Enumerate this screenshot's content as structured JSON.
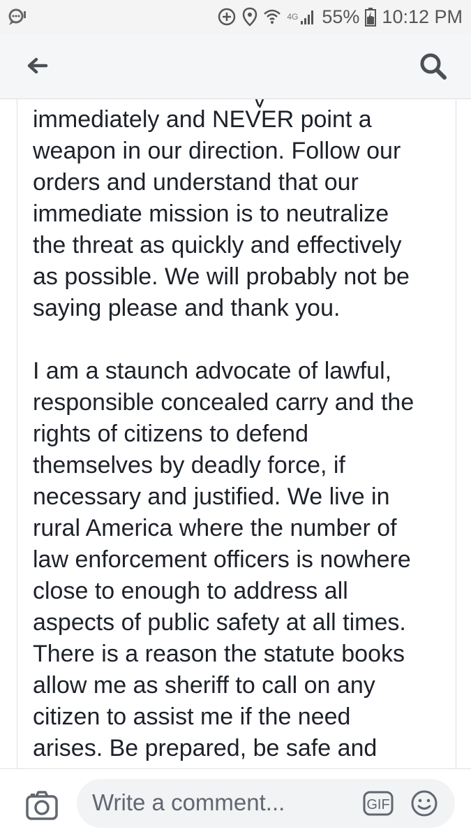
{
  "status_bar": {
    "network": "4G",
    "battery": "55%",
    "time": "10:12 PM"
  },
  "header": {
    "back_icon": "arrow-left-icon",
    "search_icon": "search-icon"
  },
  "post": {
    "paragraphs": [
      {
        "lines": [
          "immediately and NEVER point a",
          "weapon in our direction. Follow our",
          "orders and understand that our",
          "immediate mission is to neutralize",
          "the threat as quickly and effectively",
          "as possible. We will probably not be",
          "saying please and thank you."
        ]
      },
      {
        "lines": [
          "I am a staunch advocate of lawful,",
          "responsible concealed carry and the",
          "rights of citizens to defend",
          "themselves by deadly force, if",
          "necessary and justified. We live in",
          "rural America where the number of",
          "law enforcement officers is nowhere",
          "close to enough to address all",
          "aspects of public safety at all times.",
          "There is a reason the statute books",
          "allow me as sheriff to call on any",
          "citizen to assist me if the need",
          "arises. Be prepared, be safe and"
        ]
      }
    ]
  },
  "footer": {
    "camera_icon": "camera-icon",
    "comment_placeholder": "Write a comment...",
    "gif_label": "GIF",
    "emoji_icon": "smiley-icon"
  }
}
